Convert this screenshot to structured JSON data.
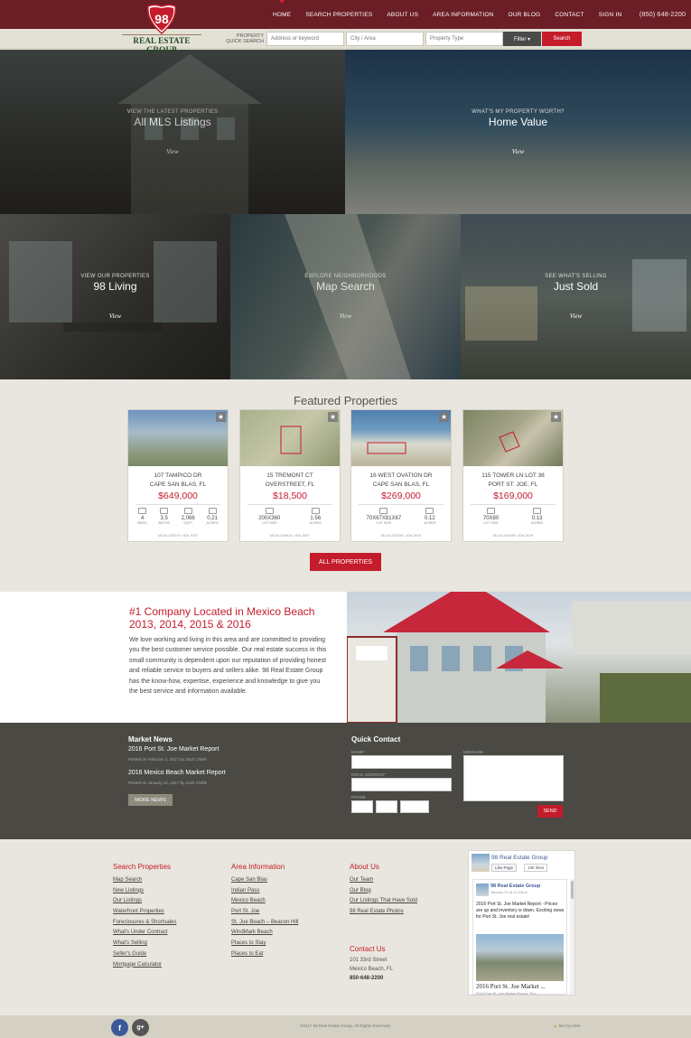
{
  "header": {
    "logo_number": "98",
    "logo_text": "REAL ESTATE GROUP",
    "nav": [
      "HOME",
      "SEARCH PROPERTIES",
      "ABOUT US",
      "AREA INFORMATION",
      "OUR BLOG",
      "CONTACT",
      "SIGN IN"
    ],
    "phone": "(850) 648-2200"
  },
  "quick_search": {
    "label_line1": "PROPERTY",
    "label_line2": "QUICK SEARCH",
    "address_placeholder": "Address or keyword",
    "city_placeholder": "City / Area",
    "type_placeholder": "Property Type",
    "filter_label": "Filter ▾",
    "search_label": "Search"
  },
  "tiles": [
    {
      "sub": "VIEW THE LATEST PROPERTIES",
      "title": "All MLS Listings",
      "link": "View"
    },
    {
      "sub": "WHAT'S MY PROPERTY WORTH?",
      "title": "Home Value",
      "link": "View"
    },
    {
      "sub": "VIEW OUR PROPERTIES",
      "title": "98 Living",
      "link": "View"
    },
    {
      "sub": "EXPLORE NEIGHBORHOODS",
      "title": "Map Search",
      "link": "View"
    },
    {
      "sub": "SEE WHAT'S SELLING",
      "title": "Just Sold",
      "link": "View"
    }
  ],
  "featured": {
    "title": "Featured Properties",
    "cards": [
      {
        "street": "107 TAMPICO DR",
        "city": "CAPE SAN BLAS, FL",
        "price": "$649,000",
        "stats": [
          {
            "v": "4",
            "l": "BEDS"
          },
          {
            "v": "3.5",
            "l": "BATHS"
          },
          {
            "v": "2,066",
            "l": "SQFT"
          },
          {
            "v": "0.21",
            "l": "ACRES"
          }
        ],
        "mls": "MLS# 255219 / ID# 7057"
      },
      {
        "street": "15 TREMONT CT",
        "city": "OVERSTREET, FL",
        "price": "$18,500",
        "stats": [
          {
            "v": "200X360",
            "l": "LOT SIZE"
          },
          {
            "v": "1.56",
            "l": "ACRES"
          }
        ],
        "mls": "MLS# 255814 / ID# 3897"
      },
      {
        "street": "16 WEST OVATION DR",
        "city": "CAPE SAN BLAS, FL",
        "price": "$269,000",
        "stats": [
          {
            "v": "70X67X81X67",
            "l": "LOT SIZE"
          },
          {
            "v": "0.12",
            "l": "ACRES"
          }
        ],
        "mls": "MLS# 255784 / ID# 3015"
      },
      {
        "street": "115 TOWER LN LOT 38",
        "city": "PORT ST. JOE, FL",
        "price": "$169,000",
        "stats": [
          {
            "v": "70X80",
            "l": "LOT SIZE"
          },
          {
            "v": "0.13",
            "l": "ACRES"
          }
        ],
        "mls": "MLS# 252689 / ID# 3029"
      }
    ],
    "all_button": "ALL PROPERTIES"
  },
  "about": {
    "heading": "#1 Company Located in Mexico Beach 2013, 2014, 2015 & 2016",
    "body": "We love working and living in this area and are committed to providing you the best customer service possible. Our real estate success in this small community is dependent upon our reputation of providing honest and reliable service to buyers and sellers alike. 98 Real Estate Group has the know-how, expertise, experience and knowledge to give you the best service and information available."
  },
  "market_news": {
    "heading": "Market News",
    "items": [
      {
        "title": "2016 Port St. Joe Market Report",
        "meta": "Posted on February 1, 2017 by Zach Childs"
      },
      {
        "title": "2016 Mexico Beach Market Report",
        "meta": "Posted on January 12, 2017 by Zach Childs"
      }
    ],
    "more_button": "MORE NEWS"
  },
  "quick_contact": {
    "heading": "Quick Contact",
    "name_label": "NAME*",
    "email_label": "EMAIL ADDRESS*",
    "phone_label": "PHONE",
    "message_label": "MESSAGE",
    "send_button": "SEND"
  },
  "footer": {
    "search_heading": "Search Properties",
    "search_links": [
      "Map Search",
      "New Listings",
      "Our Listings",
      "Waterfront Properties",
      "Foreclosures & Shortsales",
      "What's Under Contract",
      "What's Selling",
      "Seller's Guide",
      "Mortgage Calculator"
    ],
    "area_heading": "Area Information",
    "area_links": [
      "Cape San Blas",
      "Indian Pass",
      "Mexico Beach",
      "Port St. Joe",
      "St. Joe Beach – Beacon Hill",
      "WindMark Beach",
      "Places to Stay",
      "Places to Eat"
    ],
    "about_heading": "About Us",
    "about_links": [
      "Our Team",
      "Our Blog",
      "Our Listings That Have Sold",
      "98 Real Estate Photos"
    ],
    "contact_heading": "Contact Us",
    "contact_street": "101 33rd Street",
    "contact_city": "Mexico Beach, FL",
    "contact_phone": "850-648-2200"
  },
  "facebook": {
    "page_name": "98 Real Estate Group",
    "like_label": "Like Page",
    "likes": "13K likes",
    "post_author": "98 Real Estate Group",
    "post_date": "January 21 at 12:23pm",
    "post_text": "2016 Port St. Joe Market Report - Prices are up and inventory is down. Exciting news for Port St. Joe real estate!",
    "post_title": "2016 Port St. Joe Market ...",
    "post_sub": "2016 Port St. Joe Market Report. Pric..."
  },
  "bottom": {
    "facebook_glyph": "f",
    "google_glyph": "g+",
    "copyright": "©2017 98 Real Estate Group. All Rights Reserved.",
    "credit": "Site by KMA"
  }
}
